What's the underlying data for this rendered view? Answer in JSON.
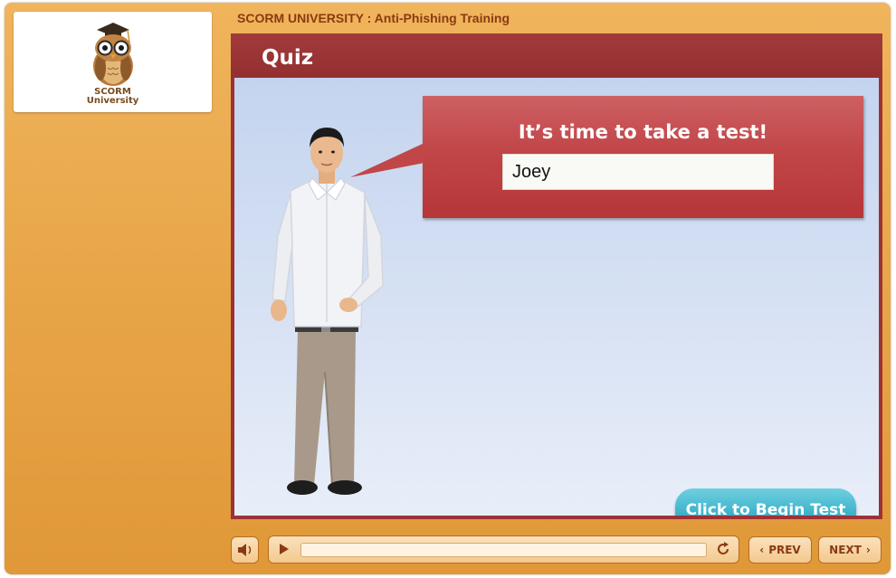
{
  "course": {
    "title": "SCORM UNIVERSITY : Anti-Phishing Training"
  },
  "logo": {
    "line1": "SCORM",
    "line2": "University"
  },
  "slide": {
    "title": "Quiz",
    "bubble_text": "It’s time to take a test!",
    "name_input_value": "Joey",
    "begin_button": "Click to Begin Test"
  },
  "player": {
    "progress": 0.0
  },
  "nav": {
    "prev": "PREV",
    "next": "NEXT"
  },
  "colors": {
    "accent": "#e7a446",
    "slide": "#9b3236",
    "button": "#41b4cc"
  },
  "icons": {
    "volume": "speaker-icon",
    "play": "play-icon",
    "replay": "replay-icon",
    "prev": "chevron-left-icon",
    "next": "chevron-right-icon"
  }
}
